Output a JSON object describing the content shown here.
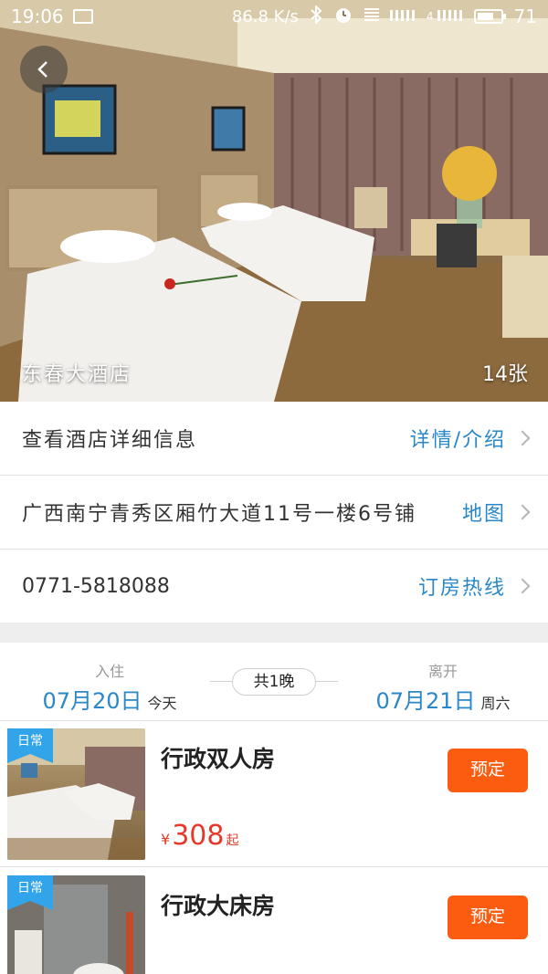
{
  "status_bar": {
    "time": "19:06",
    "speed": "86.8 K/s",
    "signal": "4",
    "battery": "71",
    "battery_level": 0.71
  },
  "hero": {
    "hotel_name": "东春大酒店",
    "photo_count": "14张"
  },
  "info": {
    "details": {
      "text": "查看酒店详细信息",
      "action": "详情/介绍"
    },
    "address": {
      "text": "广西南宁青秀区厢竹大道11号一楼6号铺",
      "action": "地图"
    },
    "phone": {
      "text": "0771-5818088",
      "action": "订房热线"
    }
  },
  "stay": {
    "checkin_label": "入住",
    "checkin_date": "07月20日",
    "checkin_day": "今天",
    "nights": "共1晚",
    "checkout_label": "离开",
    "checkout_date": "07月21日",
    "checkout_day": "周六"
  },
  "rooms": [
    {
      "tag": "日常",
      "name": "行政双人房",
      "currency": "¥",
      "price": "308",
      "suffix": "起",
      "book_label": "预定"
    },
    {
      "tag": "日常",
      "name": "行政大床房",
      "book_label": "预定"
    }
  ],
  "colors": {
    "accent": "#2a87c8",
    "book": "#fb5c10",
    "price": "#e7382a",
    "tag": "#32a4ea"
  },
  "icons": [
    "back-arrow-icon",
    "chevron-right-icon",
    "bluetooth-icon",
    "alarm-icon",
    "message-icon",
    "battery-icon"
  ]
}
